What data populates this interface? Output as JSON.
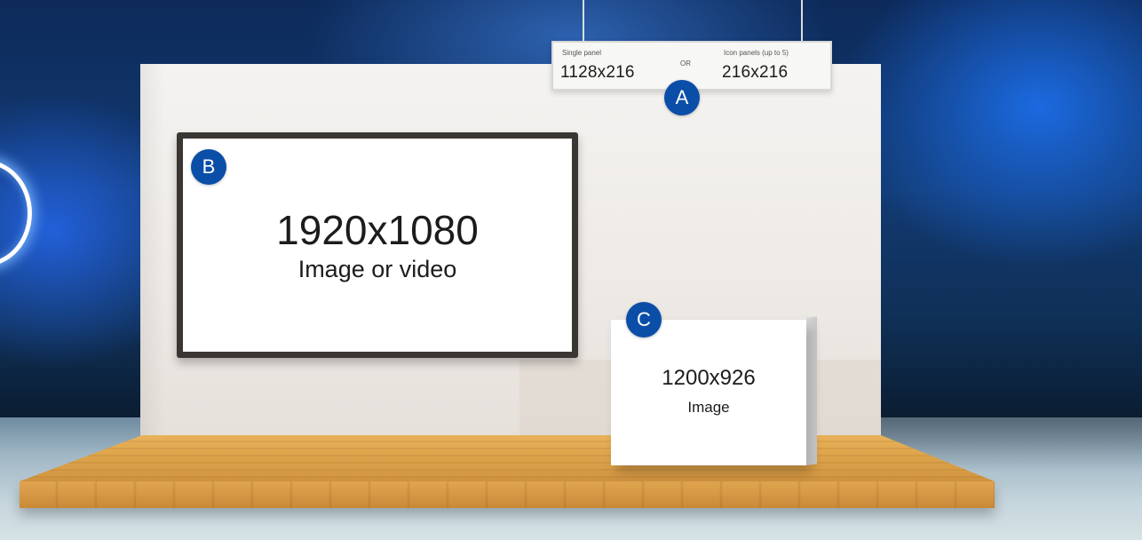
{
  "panel_a": {
    "badge": "A",
    "single_panel_label": "Single panel",
    "single_panel_size": "1128x216",
    "or_label": "OR",
    "icon_panels_label": "Icon panels (up to 5)",
    "icon_panels_size": "216x216"
  },
  "panel_b": {
    "badge": "B",
    "size": "1920x1080",
    "media": "Image or video"
  },
  "panel_c": {
    "badge": "C",
    "size": "1200x926",
    "media": "Image"
  },
  "colors": {
    "badge": "#0b4ea8",
    "wood": "#dca24a",
    "wall": "#f2f0ee"
  }
}
